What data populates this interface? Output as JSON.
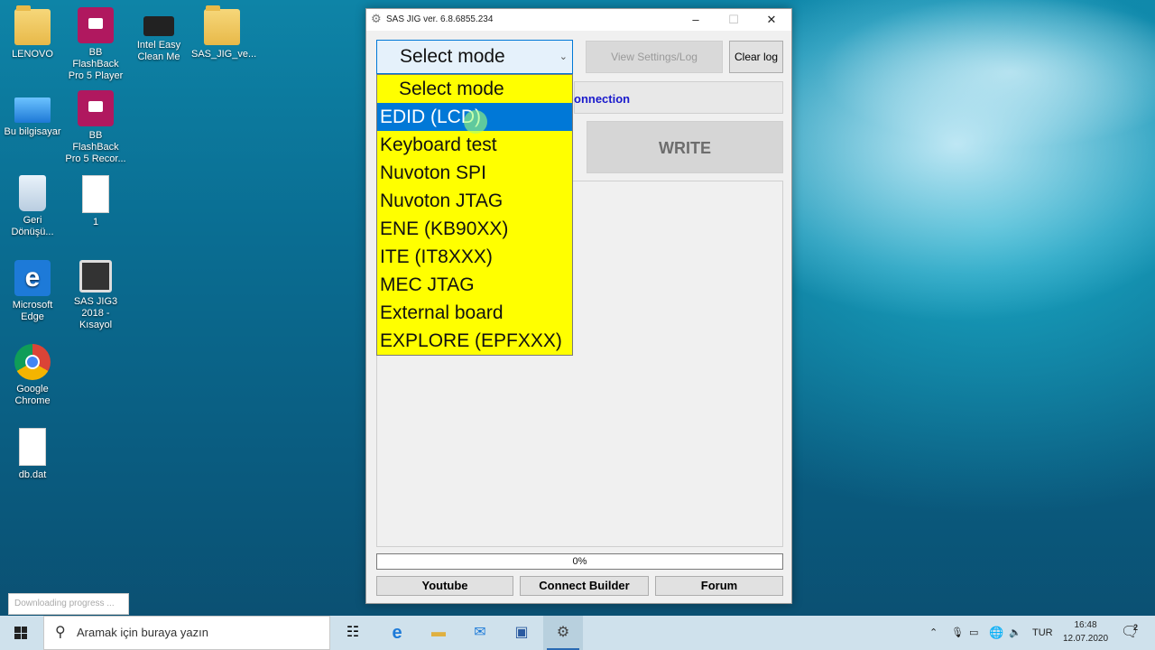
{
  "desktop": {
    "icons": [
      {
        "label": "LENOVO",
        "icon": "folder-user-icon"
      },
      {
        "label": "BB FlashBack Pro 5 Player",
        "icon": "video-player-icon"
      },
      {
        "label": "Intel Easy Clean Me",
        "icon": "chip-icon"
      },
      {
        "label": "SAS_JIG_ve...",
        "icon": "folder-icon"
      },
      {
        "label": "Bu bilgisayar",
        "icon": "computer-icon"
      },
      {
        "label": "BB FlashBack Pro 5 Recor...",
        "icon": "video-recorder-icon"
      },
      {
        "label": "Geri Dönüşü...",
        "icon": "recycle-bin-icon"
      },
      {
        "label": "1",
        "icon": "file-icon"
      },
      {
        "label": "Microsoft Edge",
        "icon": "edge-icon"
      },
      {
        "label": "SAS JIG3 2018 - Kısayol",
        "icon": "sas-jig-icon"
      },
      {
        "label": "Google Chrome",
        "icon": "chrome-icon"
      },
      {
        "label": "db.dat",
        "icon": "file-icon"
      }
    ]
  },
  "window": {
    "title": "SAS JIG ver. 6.8.6855.234",
    "minimize": "–",
    "maximize": "☐",
    "close": "✕"
  },
  "mode_select": {
    "value": "Select mode",
    "options": [
      "Select mode",
      "EDID (LCD)",
      "Keyboard test",
      "Nuvoton SPI",
      "Nuvoton JTAG",
      "ENE  (KB90XX)",
      "ITE  (IT8XXX)",
      "MEC JTAG",
      "External board",
      "EXPLORE (EPFXXX)"
    ],
    "highlighted_index": 1
  },
  "buttons": {
    "view_settings": "View Settings/Log",
    "clear_log": "Clear log",
    "write": "WRITE",
    "youtube": "Youtube",
    "connect_builder": "Connect Builder",
    "forum": "Forum"
  },
  "connection_status": "onnection",
  "progress": {
    "text": "0%",
    "value": 0
  },
  "toast": "Downloading progress ...",
  "taskbar": {
    "search_placeholder": "Aramak için buraya yazın",
    "language": "TUR",
    "time": "16:48",
    "date": "12.07.2020",
    "notification_count": "2"
  },
  "colors": {
    "dropdown_bg": "#ffff00",
    "selection": "#0078d7",
    "connection_text": "#1a1acc"
  }
}
